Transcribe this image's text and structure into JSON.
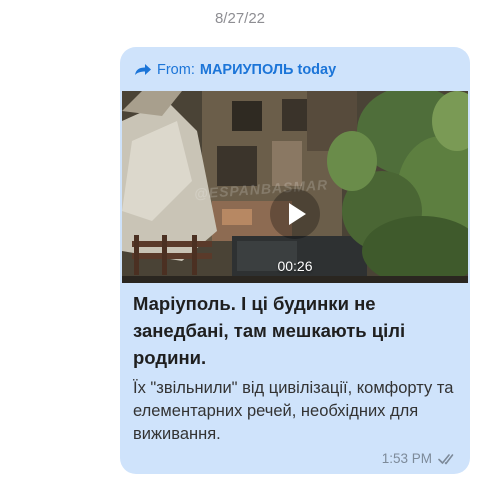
{
  "conversation": {
    "date_divider": "8/27/22"
  },
  "message": {
    "forward_prefix": "From:",
    "forward_channel": "МАРИУПОЛЬ today",
    "video": {
      "duration": "00:26",
      "watermark": "@ESPANBASMAR"
    },
    "headline": "Маріуполь. І ці будинки не занедбані, там мешкають цілі родини.",
    "body": "Їх \"звільнили\" від цивілізації, комфорту та елементарних речей, необхідних для виживання.",
    "time": "1:53 PM",
    "status": "read"
  },
  "icons": {
    "forward": "forward-arrow-icon",
    "play": "play-icon",
    "read_status": "double-check-icon"
  },
  "colors": {
    "bubble": "#cfe3fb",
    "link": "#1c75d8",
    "meta": "#7d8a99"
  }
}
